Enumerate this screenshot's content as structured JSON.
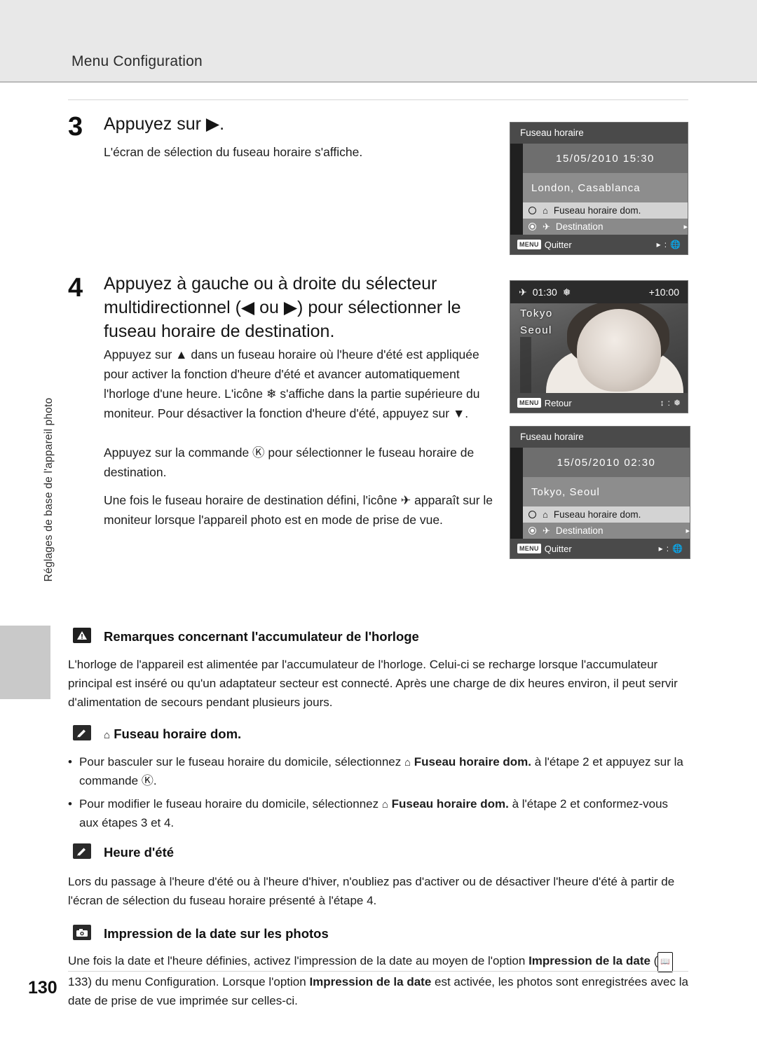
{
  "header": {
    "title": "Menu Configuration"
  },
  "side_text": "Réglages de base de l'appareil photo",
  "page_number": "130",
  "steps": [
    {
      "num": "3",
      "title": "Appuyez sur ▶.",
      "body": "L'écran de sélection du fuseau horaire s'affiche."
    },
    {
      "num": "4",
      "title": "Appuyez à gauche ou à droite du sélecteur multidirectionnel (◀ ou ▶) pour sélectionner le fuseau horaire de destination.",
      "para1": "Appuyez sur ▲ dans un fuseau horaire où l'heure d'été est appliquée pour activer la fonction d'heure d'été et avancer automatiquement l'horloge d'une heure. L'icône ❄ s'affiche dans la partie supérieure du moniteur. Pour désactiver la fonction d'heure d'été, appuyez sur ▼.",
      "para2": "Appuyez sur la commande Ⓚ pour sélectionner le fuseau horaire de destination.",
      "para3": "Une fois le fuseau horaire de destination défini, l'icône ✈ apparaît sur le moniteur lorsque l'appareil photo est en mode de prise de vue."
    }
  ],
  "screens": {
    "tz_london": {
      "title": "Fuseau horaire",
      "datetime": "15/05/2010 15:30",
      "city": "London, Casablanca",
      "home_label": "Fuseau horaire dom.",
      "dest_label": "Destination",
      "footer_left": "Quitter",
      "footer_menu_chip": "MENU",
      "footer_right": ":"
    },
    "photo": {
      "time": "01:30",
      "offset": "+10:00",
      "city_line1": "Tokyo",
      "city_line2": "Seoul",
      "footer_left": "Retour",
      "footer_menu_chip": "MENU"
    },
    "tz_tokyo": {
      "title": "Fuseau horaire",
      "datetime": "15/05/2010 02:30",
      "city": "Tokyo, Seoul",
      "home_label": "Fuseau horaire dom.",
      "dest_label": "Destination",
      "footer_left": "Quitter",
      "footer_menu_chip": "MENU"
    }
  },
  "notes": {
    "clock_battery": {
      "icon": "warning-icon",
      "heading": "Remarques concernant l'accumulateur de l'horloge",
      "body": "L'horloge de l'appareil est alimentée par l'accumulateur de l'horloge. Celui-ci se recharge lorsque l'accumulateur principal est inséré ou qu'un adaptateur secteur est connecté. Après une charge de dix heures environ, il peut servir d'alimentation de secours pendant plusieurs jours."
    },
    "home_tz": {
      "icon": "pencil-icon",
      "heading": "Fuseau horaire dom.",
      "bullets": [
        {
          "prefix": "Pour basculer sur le fuseau horaire du domicile, sélectionnez ",
          "bold": "Fuseau horaire dom.",
          "suffix": " à l'étape 2 et appuyez sur la commande Ⓚ."
        },
        {
          "prefix": "Pour modifier le fuseau horaire du domicile, sélectionnez ",
          "bold": "Fuseau horaire dom.",
          "suffix": " à l'étape 2 et conformez-vous aux étapes 3 et 4."
        }
      ]
    },
    "dst": {
      "icon": "pencil-icon",
      "heading": "Heure d'été",
      "body": "Lors du passage à l'heure d'été ou à l'heure d'hiver, n'oubliez pas d'activer ou de désactiver l'heure d'été à partir de l'écran de sélection du fuseau horaire présenté à l'étape 4."
    },
    "date_print": {
      "icon": "camera-icon",
      "heading": "Impression de la date sur les photos",
      "line1_a": "Une fois la date et l'heure définies, activez l'impression de la date au moyen de l'option ",
      "line1_b": "Impression de la",
      "line2_a": "date",
      "line2_ref": "133",
      "line2_b": ") du menu Configuration. Lorsque l'option ",
      "line2_c": "Impression de la date",
      "line2_d": " est activée, les photos sont",
      "line3": "enregistrées avec la date de prise de vue imprimée sur celles-ci."
    }
  }
}
